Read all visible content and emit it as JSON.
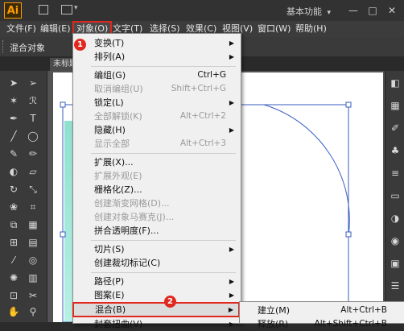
{
  "app": {
    "logo": "Ai",
    "workspace": "基本功能",
    "workspace_arrow": "▾"
  },
  "window_controls": {
    "minimize": "—",
    "maximize": "□",
    "close": "✕"
  },
  "menubar": {
    "items": [
      "文件(F)",
      "编辑(E)",
      "对象(O)",
      "文字(T)",
      "选择(S)",
      "效果(C)",
      "视图(V)",
      "窗口(W)",
      "帮助(H)"
    ]
  },
  "controlbar": {
    "label": "混合对象"
  },
  "document": {
    "tab_label": "未标题"
  },
  "dropdown": {
    "items": [
      {
        "label": "变换(T)",
        "shortcut": "",
        "submenu": true,
        "disabled": false
      },
      {
        "label": "排列(A)",
        "shortcut": "",
        "submenu": true,
        "disabled": false
      },
      {
        "label": "编组(G)",
        "shortcut": "Ctrl+G",
        "submenu": false,
        "disabled": false
      },
      {
        "label": "取消编组(U)",
        "shortcut": "Shift+Ctrl+G",
        "submenu": false,
        "disabled": true
      },
      {
        "label": "锁定(L)",
        "shortcut": "",
        "submenu": true,
        "disabled": false
      },
      {
        "label": "全部解锁(K)",
        "shortcut": "Alt+Ctrl+2",
        "submenu": false,
        "disabled": true
      },
      {
        "label": "隐藏(H)",
        "shortcut": "",
        "submenu": true,
        "disabled": false
      },
      {
        "label": "显示全部",
        "shortcut": "Alt+Ctrl+3",
        "submenu": false,
        "disabled": true
      },
      {
        "label": "扩展(X)...",
        "shortcut": "",
        "submenu": false,
        "disabled": false
      },
      {
        "label": "扩展外观(E)",
        "shortcut": "",
        "submenu": false,
        "disabled": true
      },
      {
        "label": "栅格化(Z)...",
        "shortcut": "",
        "submenu": false,
        "disabled": false
      },
      {
        "label": "创建渐变网格(D)...",
        "shortcut": "",
        "submenu": false,
        "disabled": true
      },
      {
        "label": "创建对象马赛克(J)...",
        "shortcut": "",
        "submenu": false,
        "disabled": true
      },
      {
        "label": "拼合透明度(F)...",
        "shortcut": "",
        "submenu": false,
        "disabled": false
      },
      {
        "label": "切片(S)",
        "shortcut": "",
        "submenu": true,
        "disabled": false
      },
      {
        "label": "创建裁切标记(C)",
        "shortcut": "",
        "submenu": false,
        "disabled": false
      },
      {
        "label": "路径(P)",
        "shortcut": "",
        "submenu": true,
        "disabled": false
      },
      {
        "label": "图案(E)",
        "shortcut": "",
        "submenu": true,
        "disabled": false
      },
      {
        "label": "混合(B)",
        "shortcut": "",
        "submenu": true,
        "disabled": false
      },
      {
        "label": "封套扭曲(V)",
        "shortcut": "",
        "submenu": true,
        "disabled": false
      }
    ],
    "submenu_arrow": "▶"
  },
  "submenu": {
    "items": [
      {
        "label": "建立(M)",
        "shortcut": "Alt+Ctrl+B"
      },
      {
        "label": "释放(R)",
        "shortcut": "Alt+Shift+Ctrl+B"
      }
    ]
  },
  "badges": {
    "step1": "1",
    "step2": "2"
  },
  "colors": {
    "accent_red": "#e0281f",
    "ai_orange": "#ff9a00",
    "path_blue": "#3a5dbf"
  }
}
